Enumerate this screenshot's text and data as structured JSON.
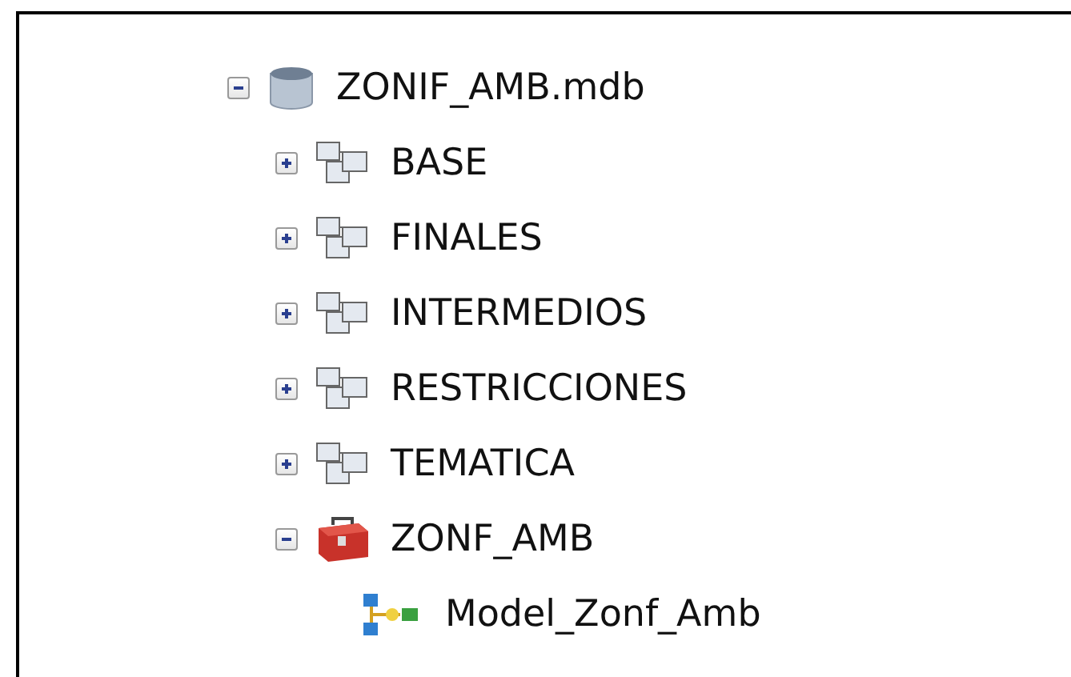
{
  "tree": [
    {
      "label": "ZONIF_AMB.mdb",
      "kind": "database",
      "expanded": true,
      "children": [
        {
          "label": "BASE",
          "kind": "dataset",
          "expanded": false
        },
        {
          "label": "FINALES",
          "kind": "dataset",
          "expanded": false
        },
        {
          "label": "INTERMEDIOS",
          "kind": "dataset",
          "expanded": false
        },
        {
          "label": "RESTRICCIONES",
          "kind": "dataset",
          "expanded": false
        },
        {
          "label": "TEMATICA",
          "kind": "dataset",
          "expanded": false
        },
        {
          "label": "ZONF_AMB",
          "kind": "toolbox",
          "expanded": true,
          "children": [
            {
              "label": "Model_Zonf_Amb",
              "kind": "model"
            }
          ]
        }
      ]
    }
  ]
}
